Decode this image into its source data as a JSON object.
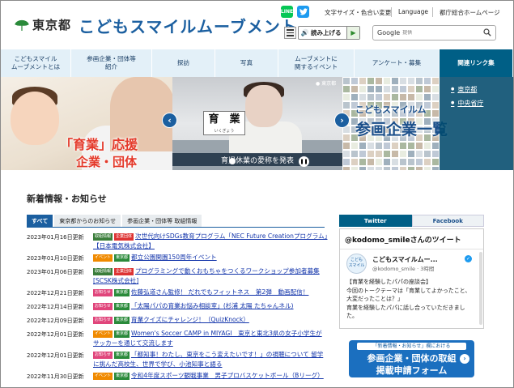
{
  "header": {
    "tokyo_name": "東京都",
    "site_title": "こどもスマイルムーブメント",
    "line_label": "LINE",
    "font_size_link": "文字サイズ・色合い変更",
    "language_link": "Language",
    "homepage_link": "都庁総合ホームページ",
    "readaloud_label": "読み上げる",
    "search_engine": "Google",
    "search_placeholder": "提供"
  },
  "nav": {
    "items": [
      {
        "label": "こどもスマイル\nムーブメントとは"
      },
      {
        "label": "参画企業・団体等\n紹介"
      },
      {
        "label": "探訪"
      },
      {
        "label": "写真"
      },
      {
        "label": "ムーブメントに\n関するイベント"
      },
      {
        "label": "アンケート・募集"
      },
      {
        "label": "関連リンク集"
      }
    ]
  },
  "hero": {
    "slide1_line1": "「育業」応援",
    "slide1_line2": "企業・団体",
    "nameplate_main": "育　業",
    "nameplate_sub": "いくぎょう",
    "tokyo_badge": "● 東京都",
    "caption": "育児休業の愛称を発表",
    "slide3_line1": "こどもスマイルム",
    "slide3_line2": "参画企業一覧",
    "related_links": [
      "東京都",
      "中央省庁"
    ]
  },
  "news": {
    "heading": "新着情報・お知らせ",
    "tabs": [
      "すべて",
      "東京都からのお知らせ",
      "参画企業・団体等 取組情報"
    ],
    "rows": [
      {
        "date": "2023年01月16日更新",
        "badges": [
          {
            "text": "取組情報",
            "color": "#3a7d3a"
          },
          {
            "text": "企業団体",
            "color": "#d33"
          }
        ],
        "text": "次世代向けSDGs教育プログラム「NEC Future Creationプログラム」【日本電気株式会社】"
      },
      {
        "date": "2023年01月10日更新",
        "badges": [
          {
            "text": "イベント",
            "color": "#f08a00"
          },
          {
            "text": "東京都",
            "color": "#2a8a3a"
          }
        ],
        "text": "都立公園開園150周年イベント"
      },
      {
        "date": "2023年01月06日更新",
        "badges": [
          {
            "text": "取組情報",
            "color": "#3a7d3a"
          },
          {
            "text": "企業団体",
            "color": "#d33"
          }
        ],
        "text": "プログラミングで動くおもちゃをつくるワークショップ参加者募集[SCSK株式会社]"
      },
      {
        "date": "2022年12月21日更新",
        "badges": [
          {
            "text": "お知らせ",
            "color": "#e0457b"
          },
          {
            "text": "東京都",
            "color": "#2a8a3a"
          }
        ],
        "text": "佐藤弘道さん監修！ だれでもフィットネス　第2弾　動画配信！"
      },
      {
        "date": "2022年12月14日更新",
        "badges": [
          {
            "text": "お知らせ",
            "color": "#e0457b"
          },
          {
            "text": "東京都",
            "color": "#2a8a3a"
          }
        ],
        "text": "「太陽パパの育業お悩み相談室」(杉浦 太陽 たちゃんネル)"
      },
      {
        "date": "2022年12月09日更新",
        "badges": [
          {
            "text": "お知らせ",
            "color": "#e0457b"
          },
          {
            "text": "東京都",
            "color": "#2a8a3a"
          }
        ],
        "text": "育業クイズにチャレンジ！（QuizKnock）"
      },
      {
        "date": "2022年12月01日更新",
        "badges": [
          {
            "text": "イベント",
            "color": "#f08a00"
          },
          {
            "text": "東京都",
            "color": "#2a8a3a"
          }
        ],
        "text": "Women's Soccer CAMP in MIYAGI　東京と東北3県の女子小学生がサッカーを通じて交流します"
      },
      {
        "date": "2022年12月01日更新",
        "badges": [
          {
            "text": "お知らせ",
            "color": "#e0457b"
          },
          {
            "text": "東京都",
            "color": "#2a8a3a"
          }
        ],
        "text": "「都知事！わたし、東京をこう変えたいです！」の視聴について 留学に挑んだ高校生、世界で学び、小池知事と語る"
      },
      {
        "date": "2022年11月30日更新",
        "badges": [
          {
            "text": "イベント",
            "color": "#f08a00"
          },
          {
            "text": "東京都",
            "color": "#2a8a3a"
          }
        ],
        "text": "令和4年度スポーツ観戦事業　男子プロバスケットボール（Bリーグ）"
      }
    ]
  },
  "sidebar": {
    "tabs": [
      "Twitter",
      "Facebook"
    ],
    "tweet_header": "@kodomo_smileさんのツイート",
    "avatar_text": "こども\nスマイル",
    "account_name": "こどもスマイルムー...",
    "account_handle": "@kodomo_smile · 3時間",
    "tweet_text": "【育業を経験したパパの座談会】\n今回のトークテーマは「育業してよかったこと、大変だったことは？」\n育業を経験したパパに話し合っていただきました。",
    "banner_top": "「新着情報・お知らせ」欄における",
    "banner_line1": "参画企業・団体の取組",
    "banner_line2": "掲載申請フォーム"
  },
  "colors": {
    "brand_blue": "#1b5fa0",
    "nav_bg": "#e3f0f8",
    "nav_active": "#005f86",
    "link": "#1133aa"
  }
}
